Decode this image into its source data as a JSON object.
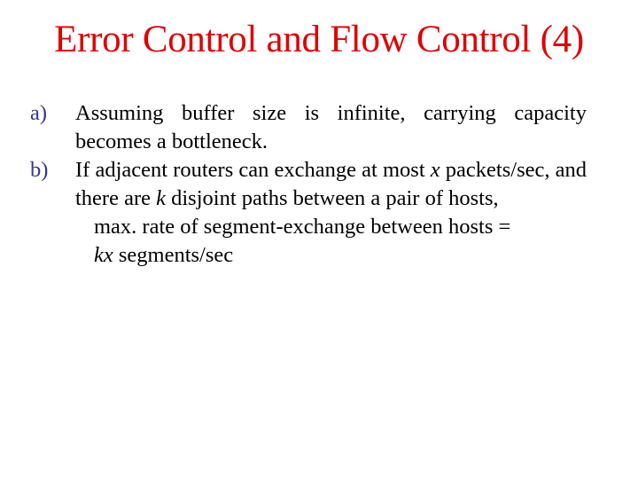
{
  "slide": {
    "title": "Error Control and Flow Control (4)",
    "title_color": "#e00000",
    "marker_color": "#333399",
    "items": [
      {
        "marker": "a)",
        "text": "Assuming buffer size is infinite, carrying capacity becomes a bottleneck."
      },
      {
        "marker": "b)",
        "text_parts": {
          "p1": "If adjacent routers can exchange at most ",
          "var_x": "x",
          "p2": " packets/sec, and there are ",
          "var_k": "k",
          "p3": " disjoint paths between a pair of hosts,"
        }
      }
    ],
    "result": {
      "line1": "max. rate of segment-exchange between hosts =",
      "var_kx": "kx",
      "line2_rest": " segments/sec"
    }
  }
}
